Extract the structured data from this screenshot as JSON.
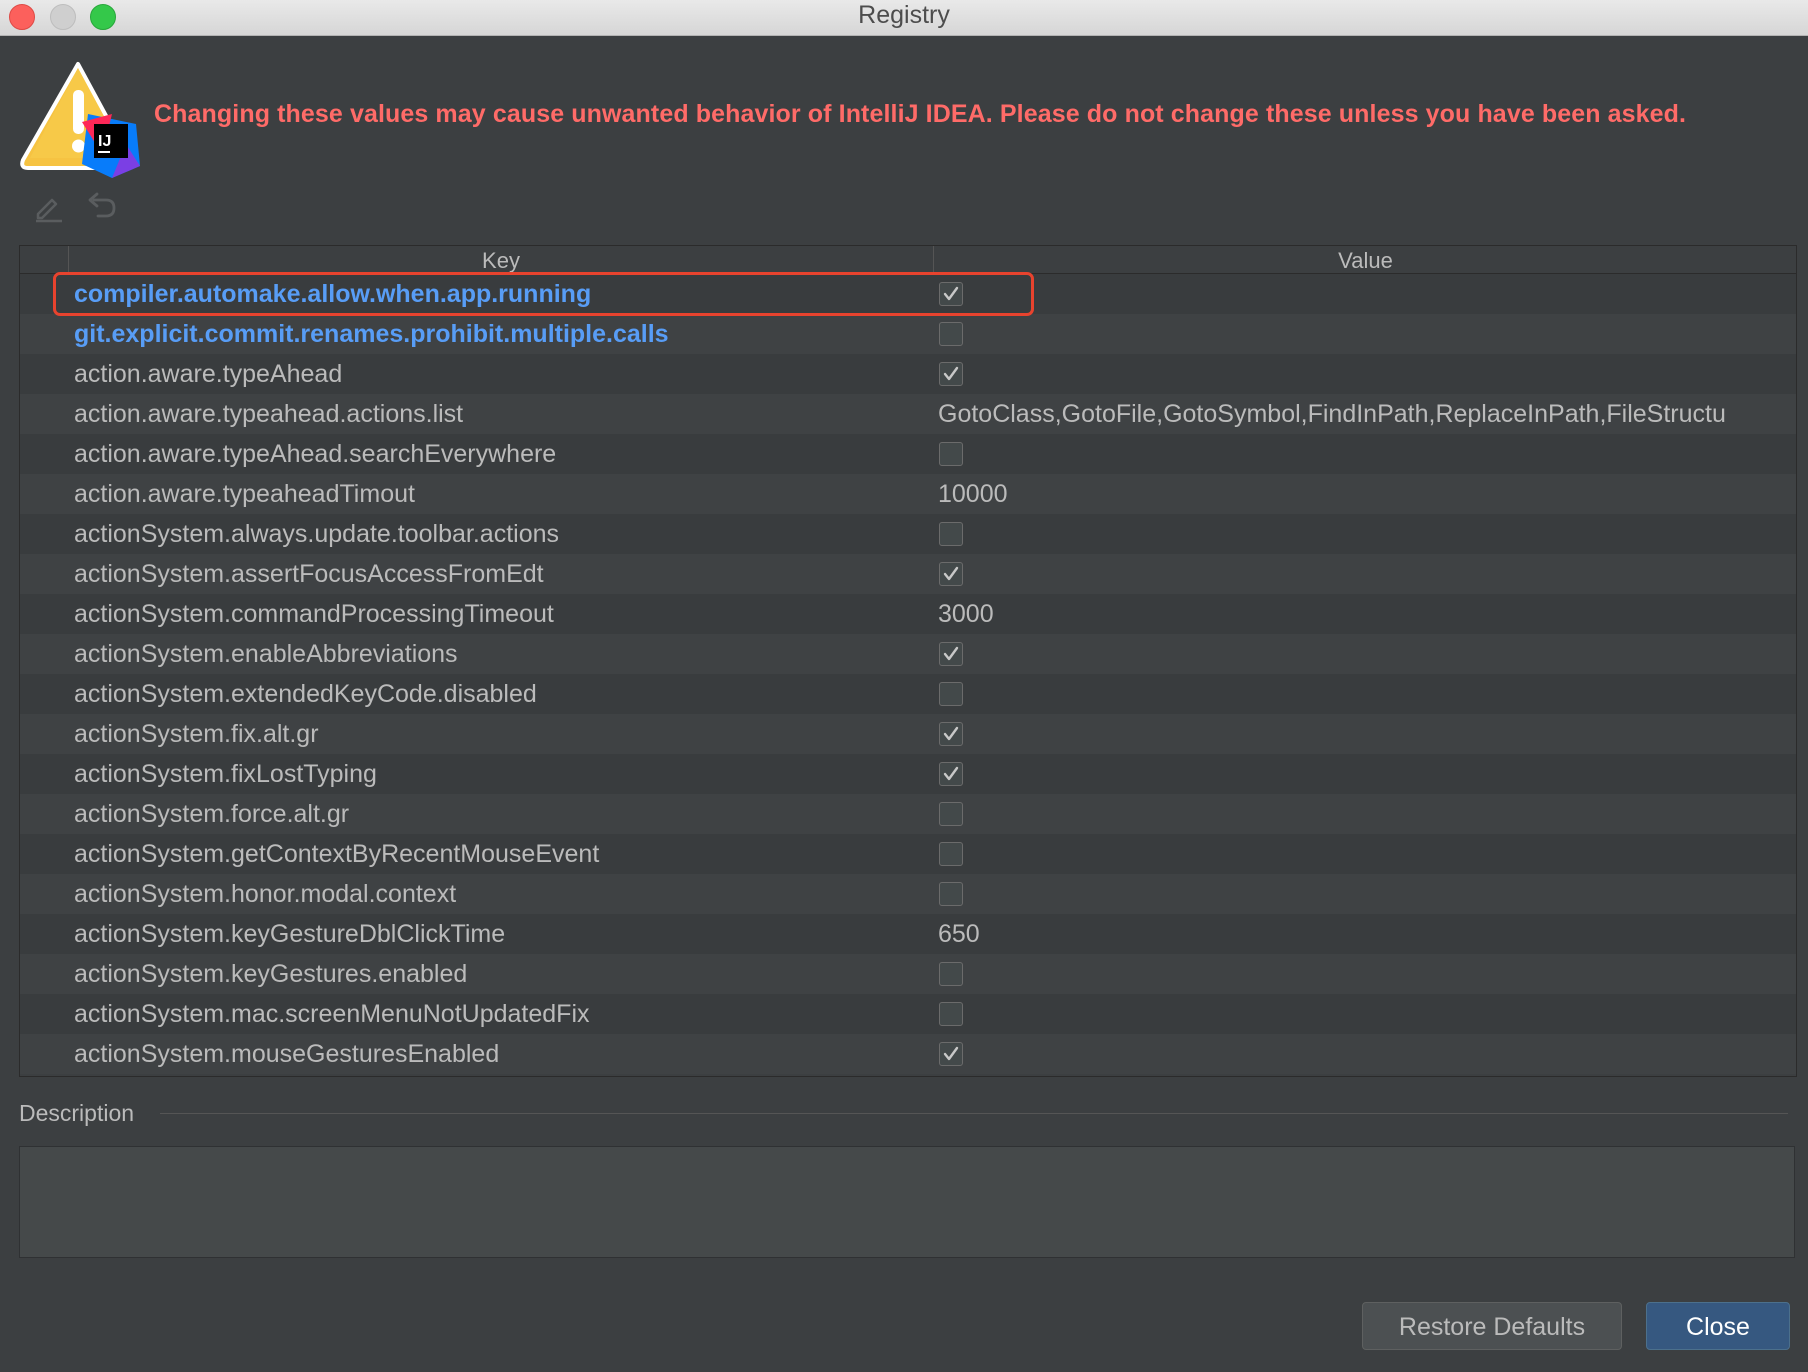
{
  "window": {
    "title": "Registry"
  },
  "warning": {
    "text": "Changing these values may cause unwanted behavior of IntelliJ IDEA. Please do not change these unless you have been asked.",
    "badge": "IJ",
    "color": "#ff6b68"
  },
  "toolbar": {
    "edit_icon": "pencil-icon",
    "revert_icon": "revert-icon"
  },
  "table": {
    "columns": [
      "Key",
      "Value"
    ],
    "rows": [
      {
        "key": "compiler.automake.allow.when.app.running",
        "type": "bool",
        "value": true,
        "modified": true
      },
      {
        "key": "git.explicit.commit.renames.prohibit.multiple.calls",
        "type": "bool",
        "value": false,
        "modified": true
      },
      {
        "key": "action.aware.typeAhead",
        "type": "bool",
        "value": true
      },
      {
        "key": "action.aware.typeahead.actions.list",
        "type": "text",
        "value": "GotoClass,GotoFile,GotoSymbol,FindInPath,ReplaceInPath,FileStructu"
      },
      {
        "key": "action.aware.typeAhead.searchEverywhere",
        "type": "bool",
        "value": false
      },
      {
        "key": "action.aware.typeaheadTimout",
        "type": "text",
        "value": "10000"
      },
      {
        "key": "actionSystem.always.update.toolbar.actions",
        "type": "bool",
        "value": false
      },
      {
        "key": "actionSystem.assertFocusAccessFromEdt",
        "type": "bool",
        "value": true
      },
      {
        "key": "actionSystem.commandProcessingTimeout",
        "type": "text",
        "value": "3000"
      },
      {
        "key": "actionSystem.enableAbbreviations",
        "type": "bool",
        "value": true
      },
      {
        "key": "actionSystem.extendedKeyCode.disabled",
        "type": "bool",
        "value": false
      },
      {
        "key": "actionSystem.fix.alt.gr",
        "type": "bool",
        "value": true
      },
      {
        "key": "actionSystem.fixLostTyping",
        "type": "bool",
        "value": true
      },
      {
        "key": "actionSystem.force.alt.gr",
        "type": "bool",
        "value": false
      },
      {
        "key": "actionSystem.getContextByRecentMouseEvent",
        "type": "bool",
        "value": false
      },
      {
        "key": "actionSystem.honor.modal.context",
        "type": "bool",
        "value": false
      },
      {
        "key": "actionSystem.keyGestureDblClickTime",
        "type": "text",
        "value": "650"
      },
      {
        "key": "actionSystem.keyGestures.enabled",
        "type": "bool",
        "value": false
      },
      {
        "key": "actionSystem.mac.screenMenuNotUpdatedFix",
        "type": "bool",
        "value": false
      },
      {
        "key": "actionSystem.mouseGesturesEnabled",
        "type": "bool",
        "value": true
      }
    ]
  },
  "description": {
    "label": "Description",
    "text": ""
  },
  "buttons": {
    "restore": "Restore Defaults",
    "close": "Close"
  },
  "colors": {
    "modified_key": "#589df6",
    "highlight": "#e8432e",
    "primary_button": "#365880"
  }
}
